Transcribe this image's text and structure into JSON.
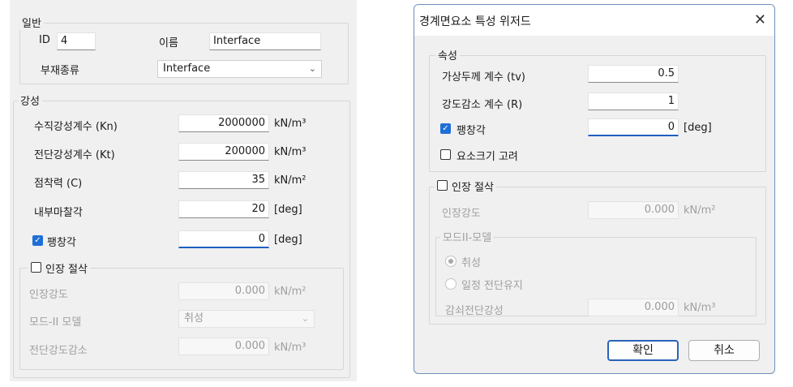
{
  "left": {
    "general": {
      "title": "일반",
      "id_label": "ID",
      "id_value": "4",
      "name_label": "이름",
      "name_value": "Interface",
      "member_type_label": "부재종류",
      "member_type_value": "Interface"
    },
    "stiffness": {
      "title": "강성",
      "rows": [
        {
          "label": "수직강성계수 (Kn)",
          "value": "2000000",
          "unit": "kN/m³"
        },
        {
          "label": "전단강성계수 (Kt)",
          "value": "200000",
          "unit": "kN/m³"
        },
        {
          "label": "점착력 (C)",
          "value": "35",
          "unit": "kN/m²"
        },
        {
          "label": "내부마찰각",
          "value": "20",
          "unit": "[deg]"
        }
      ],
      "dilation_label": "팽창각",
      "dilation_value": "0",
      "dilation_unit": "[deg]"
    },
    "tension": {
      "title": "인장 절삭",
      "strength_label": "인장강도",
      "strength_value": "0.000",
      "strength_unit": "kN/m²",
      "mode_label": "모드-II 모델",
      "mode_value": "취성",
      "reduction_label": "전단강도감소",
      "reduction_value": "0.000",
      "reduction_unit": "kN/m³"
    }
  },
  "dialog": {
    "title": "경계면요소 특성 위저드",
    "close_glyph": "✕",
    "props": {
      "title": "속성",
      "virtual_thickness_label": "가상두께 계수 (tv)",
      "virtual_thickness_value": "0.5",
      "strength_reduction_label": "강도감소 계수 (R)",
      "strength_reduction_value": "1",
      "dilation_label": "팽창각",
      "dilation_value": "0",
      "dilation_unit": "[deg]",
      "element_size_label": "요소크기 고려"
    },
    "tension": {
      "title": "인장 절삭",
      "strength_label": "인장강도",
      "strength_value": "0.000",
      "strength_unit": "kN/m²",
      "mode_group_title": "모드II-모델",
      "mode_brittle": "취성",
      "mode_constant": "일정 전단유지",
      "reduced_label": "감쇠전단강성",
      "reduced_value": "0.000",
      "reduced_unit": "kN/m³"
    },
    "ok_label": "확인",
    "cancel_label": "취소"
  },
  "colors": {
    "accent": "#1f6fd8",
    "panel_bg": "#f0f0f0",
    "disabled_text": "#a0a0a0"
  }
}
